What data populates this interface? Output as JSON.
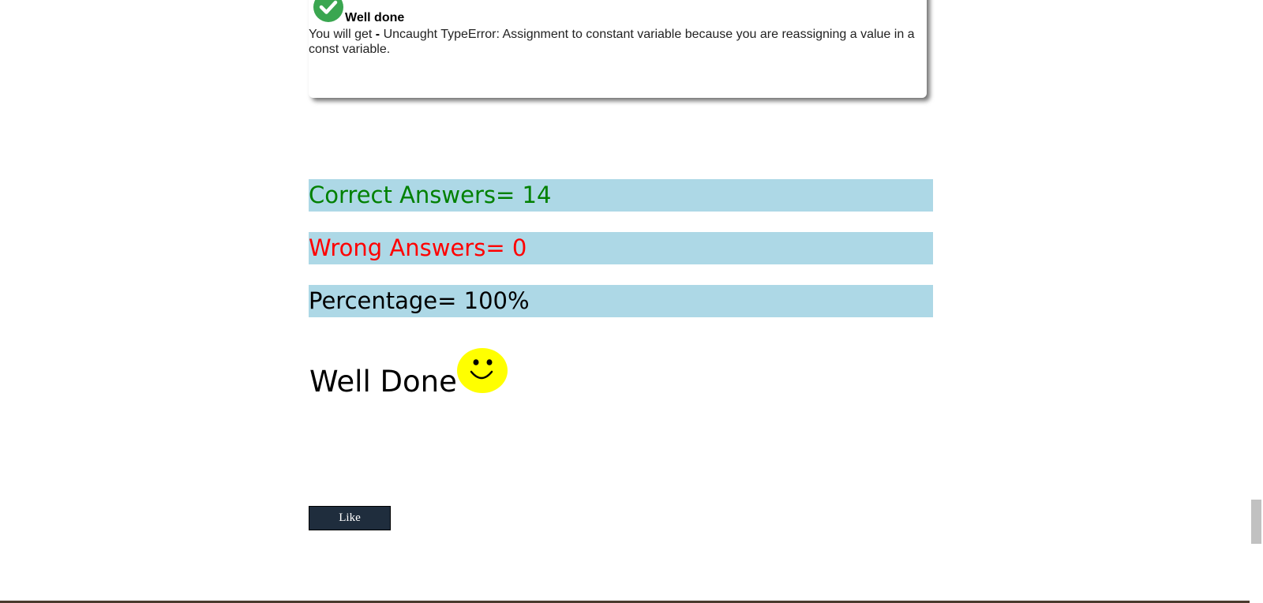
{
  "feedback": {
    "title": "Well done",
    "text_prefix": "You will get ",
    "text_dash": "-",
    "text_body": " Uncaught TypeError: Assignment to constant variable because you are reassigning a value in a const variable."
  },
  "results": {
    "correct": "Correct Answers= 14",
    "wrong": "Wrong Answers= 0",
    "percentage": "Percentage= 100%"
  },
  "summary": {
    "heading": "Well Done"
  },
  "like_button": {
    "label": "Like"
  },
  "colors": {
    "result_bar_bg": "#add8e6",
    "correct_text": "#008000",
    "wrong_text": "#ff0000",
    "check_icon": "#3aa650",
    "smiley_face": "#ffff00",
    "like_button_bg": "#1f2d3d"
  },
  "icons": {
    "feedback": "check-icon",
    "summary": "smiley-face-icon"
  }
}
